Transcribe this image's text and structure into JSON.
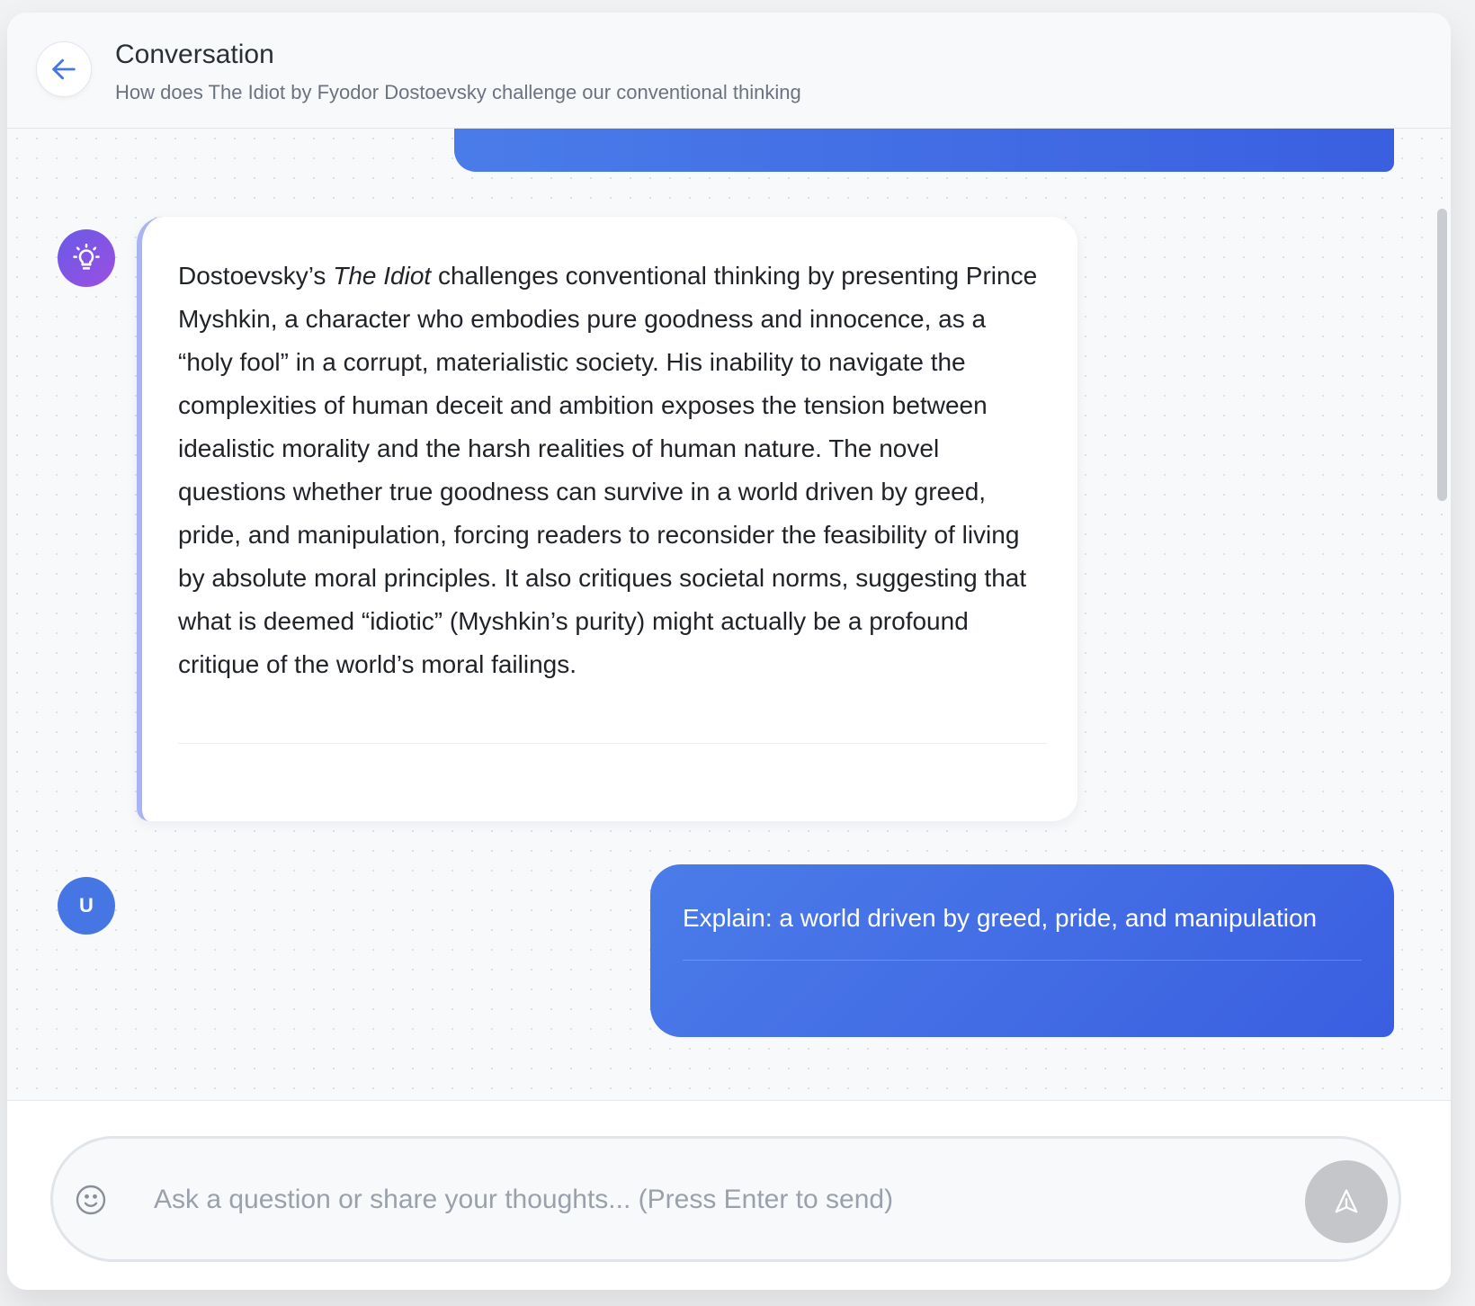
{
  "header": {
    "title": "Conversation",
    "subtitle": "How does The Idiot by Fyodor Dostoevsky challenge our conventional thinking",
    "back_icon": "arrow-left-icon"
  },
  "messages": [
    {
      "role": "user",
      "text": ""
    },
    {
      "role": "assistant",
      "avatar_icon": "lightbulb-icon",
      "text_before_title": "Dostoevsky’s ",
      "title_italic": "The Idiot",
      "text_after_title": " challenges conventional thinking by presenting Prince Myshkin, a character who embodies pure goodness and innocence, as a “holy fool” in a corrupt, materialistic society. His inability to navigate the complexities of human deceit and ambition exposes the tension between idealistic morality and the harsh realities of human nature. The novel questions whether true goodness can survive in a world driven by greed, pride, and manipulation, forcing readers to reconsider the feasibility of living by absolute moral principles. It also critiques societal norms, suggesting that what is deemed “idiotic” (Myshkin’s purity) might actually be a profound critique of the world’s moral failings."
    },
    {
      "role": "user",
      "avatar_initial": "U",
      "text": "Explain: a world driven by greed, pride, and manipulation"
    }
  ],
  "composer": {
    "placeholder": "Ask a question or share your thoughts... (Press Enter to send)",
    "value": "",
    "emoji_icon": "smiley-icon",
    "send_icon": "send-icon"
  },
  "colors": {
    "user_bubble": "#4676e4",
    "ai_accent": "#a9b5f3",
    "ai_avatar": "#7b55e4",
    "send_disabled": "#c4c6ca"
  }
}
